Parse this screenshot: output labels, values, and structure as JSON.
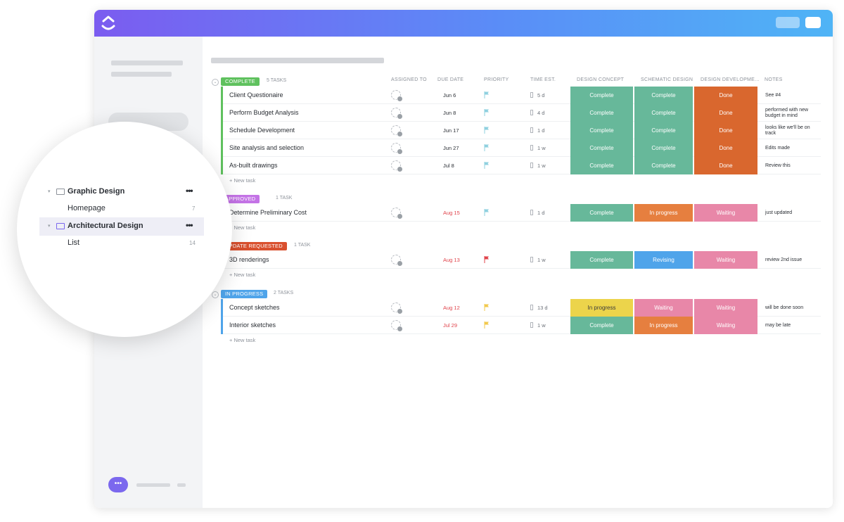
{
  "colors": {
    "complete": "#67b89a",
    "done": "#d9672e",
    "in_progress": "#e67f3f",
    "waiting": "#e887a8",
    "revising": "#4fa4ea",
    "in_progress_yellow": "#ecd44b",
    "group_complete": "#5fc15e",
    "group_approved": "#c473e6",
    "group_update": "#d9502e",
    "group_inprogress": "#4fa4ea"
  },
  "columns": [
    "ASSIGNED TO",
    "DUE DATE",
    "PRIORITY",
    "TIME EST.",
    "DESIGN CONCEPT",
    "SCHEMATIC DESIGN",
    "DESIGN DEVELOPME...",
    "NOTES"
  ],
  "groups": [
    {
      "badge": "COMPLETE",
      "count": "5 TASKS",
      "color_key": "group_complete",
      "tasks": [
        {
          "name": "Client Questionaire",
          "due": "Jun 6",
          "due_red": false,
          "flag": "#8fd0df",
          "time": "5 d",
          "s1": "Complete",
          "s1c": "complete",
          "s2": "Complete",
          "s2c": "complete",
          "s3": "Done",
          "s3c": "done",
          "note": "See #4"
        },
        {
          "name": "Perform Budget Analysis",
          "due": "Jun 8",
          "due_red": false,
          "flag": "#8fd0df",
          "time": "4 d",
          "s1": "Complete",
          "s1c": "complete",
          "s2": "Complete",
          "s2c": "complete",
          "s3": "Done",
          "s3c": "done",
          "note": "performed with new budget in mind"
        },
        {
          "name": "Schedule Development",
          "due": "Jun 17",
          "due_red": false,
          "flag": "#8fd0df",
          "time": "1 d",
          "s1": "Complete",
          "s1c": "complete",
          "s2": "Complete",
          "s2c": "complete",
          "s3": "Done",
          "s3c": "done",
          "note": "looks like we'll be on track"
        },
        {
          "name": "Site analysis and selection",
          "due": "Jun 27",
          "due_red": false,
          "flag": "#8fd0df",
          "time": "1 w",
          "s1": "Complete",
          "s1c": "complete",
          "s2": "Complete",
          "s2c": "complete",
          "s3": "Done",
          "s3c": "done",
          "note": "Edits made"
        },
        {
          "name": "As-built drawings",
          "due": "Jul 8",
          "due_red": false,
          "flag": "#8fd0df",
          "time": "1 w",
          "s1": "Complete",
          "s1c": "complete",
          "s2": "Complete",
          "s2c": "complete",
          "s3": "Done",
          "s3c": "done",
          "note": "Review this"
        }
      ],
      "new_task": "+ New task"
    },
    {
      "badge": "APPROVED",
      "count": "1 TASK",
      "color_key": "group_approved",
      "tasks": [
        {
          "name": "Determine Preliminary Cost",
          "due": "Aug 15",
          "due_red": true,
          "flag": "#8fd0df",
          "time": "1 d",
          "s1": "Complete",
          "s1c": "complete",
          "s2": "In progress",
          "s2c": "in_progress",
          "s3": "Waiting",
          "s3c": "waiting",
          "note": "just updated"
        }
      ],
      "new_task": "+ New task"
    },
    {
      "badge": "UPDATE REQUESTED",
      "count": "1 TASK",
      "color_key": "group_update",
      "tasks": [
        {
          "name": "3D renderings",
          "due": "Aug 13",
          "due_red": true,
          "flag": "#e0434b",
          "time": "1 w",
          "s1": "Complete",
          "s1c": "complete",
          "s2": "Revising",
          "s2c": "revising",
          "s3": "Waiting",
          "s3c": "waiting",
          "note": "review 2nd issue"
        }
      ],
      "new_task": "+ New task"
    },
    {
      "badge": "IN PROGRESS",
      "count": "2 TASKS",
      "color_key": "group_inprogress",
      "tasks": [
        {
          "name": "Concept sketches",
          "due": "Aug 12",
          "due_red": true,
          "flag": "#f2c94c",
          "time": "13 d",
          "s1": "In progress",
          "s1c": "in_progress_yellow",
          "s2": "Waiting",
          "s2c": "waiting",
          "s3": "Waiting",
          "s3c": "waiting",
          "note": "will be done soon"
        },
        {
          "name": "Interior sketches",
          "due": "Jul 29",
          "due_red": true,
          "flag": "#f2c94c",
          "time": "1 w",
          "s1": "Complete",
          "s1c": "complete",
          "s2": "In progress",
          "s2c": "in_progress",
          "s3": "Waiting",
          "s3c": "waiting",
          "note": "may be late"
        }
      ],
      "new_task": "+ New task"
    }
  ],
  "magnifier": {
    "items": [
      {
        "label": "Graphic Design",
        "folder": true,
        "count": "",
        "dots": "•••"
      },
      {
        "label": "Homepage",
        "folder": false,
        "count": "7",
        "dots": ""
      },
      {
        "label": "Architectural Design",
        "folder": true,
        "count": "",
        "dots": "•••"
      },
      {
        "label": "List",
        "folder": false,
        "count": "14",
        "dots": ""
      }
    ]
  },
  "chat_icon": "chat-bubble-icon",
  "chat_glyph": "•••"
}
